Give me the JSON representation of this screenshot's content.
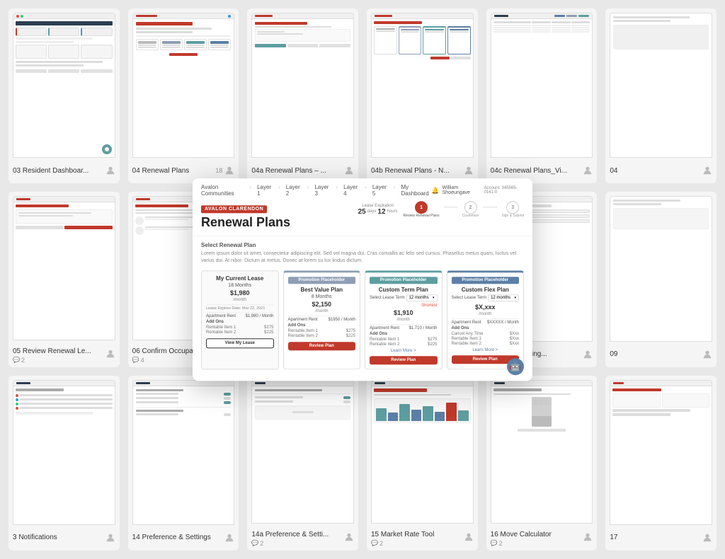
{
  "cards": [
    {
      "id": "c1",
      "title": "03 Resident Dashboar...",
      "comments": null,
      "col": 1,
      "row": 1
    },
    {
      "id": "c2",
      "title": "04 Renewal Plans",
      "comments": "18",
      "col": 2,
      "row": 1
    },
    {
      "id": "c3",
      "title": "04a Renewal Plans – ...",
      "comments": null,
      "col": 3,
      "row": 1
    },
    {
      "id": "c4",
      "title": "04b Renewal Plans - N...",
      "comments": null,
      "col": 4,
      "row": 1
    },
    {
      "id": "c5",
      "title": "04c Renewal Plans_Vi...",
      "comments": null,
      "col": 5,
      "row": 1
    },
    {
      "id": "c6",
      "title": "04",
      "comments": null,
      "col": 6,
      "row": 1
    },
    {
      "id": "c7",
      "title": "05 Review Renewal Le...",
      "comments": "2",
      "col": 1,
      "row": 2
    },
    {
      "id": "c8",
      "title": "06 Confirm Occupants",
      "comments": "4",
      "col": 2,
      "row": 2
    },
    {
      "id": "c9",
      "title": "nfirm Furnishing...",
      "comments": null,
      "col": 5,
      "row": 2
    },
    {
      "id": "c10",
      "title": "09",
      "comments": null,
      "col": 6,
      "row": 2
    },
    {
      "id": "c11",
      "title": "3 Notifications",
      "comments": null,
      "col": 1,
      "row": 3
    },
    {
      "id": "c12",
      "title": "14 Preference & Settings",
      "comments": null,
      "col": 2,
      "row": 3
    },
    {
      "id": "c13",
      "title": "14a Preference & Setti...",
      "comments": "2",
      "col": 3,
      "row": 3
    },
    {
      "id": "c14",
      "title": "15 Market Rate Tool",
      "comments": "2",
      "col": 4,
      "row": 3
    },
    {
      "id": "c15",
      "title": "16 Move Calculator",
      "comments": "2",
      "col": 5,
      "row": 3
    },
    {
      "id": "c16",
      "title": "17",
      "comments": null,
      "col": 6,
      "row": 3
    }
  ],
  "overlay": {
    "brand": "AVALON CLARENDON",
    "title": "Renewal Plans",
    "nav_items": [
      "Avalon Communities",
      "Layer 1",
      "Layer 2",
      "Layer 3",
      "Layer 4",
      "Layer 5",
      "My Dashboard"
    ],
    "user": "William Shoeungave",
    "account": "Account: 345565-0141-0",
    "notification_icon": "🔔",
    "lease_expiry_label": "Lease Expiration",
    "days_label": "25",
    "hours_label": "12",
    "steps": [
      {
        "number": "1",
        "label": "Review\nRenewal Plans",
        "active": true
      },
      {
        "number": "2",
        "label": "Customize",
        "active": false
      },
      {
        "number": "3",
        "label": "Sign\n& Submit",
        "active": false
      }
    ],
    "section_title": "Select Renewal Plan",
    "section_desc": "Lorem ipsum dolor sit amet, consectetur adipiscing elit. Sed vel magna dui. Cras convallis ac felis sed cursus. Phasellus metus quam, luctus vel varius dui. At nibor. Dictum at metus. Donec at lorem su lux lindus dictum.",
    "plans": [
      {
        "type": "current",
        "name": "My Current Lease",
        "duration": "18 Months",
        "price": "$1,980",
        "price_suffix": "/month",
        "lease_expiry": "Lease Expires Date: Mar 22, 2021",
        "rent_label": "Apartment Rent",
        "rent_value": "$1,980 / Month",
        "addons_title": "Add Ons",
        "addon1_name": "Rentable Item 1",
        "addon1_price": "$275",
        "addon2_name": "Rentable Item 2",
        "addon2_price": "$225",
        "button_label": "View My Lease",
        "button_type": "outline"
      },
      {
        "type": "promo",
        "promo_label": "Promotion Placeholder",
        "promo_color": "blue",
        "name": "Best Value Plan",
        "duration": "8 Months",
        "price": "$2,150",
        "price_suffix": "/month",
        "rent_label": "Apartment Rent",
        "rent_value": "$1950 / Month",
        "addons_title": "Add Ons",
        "addon1_name": "Rentable Item 1",
        "addon1_price": "$275",
        "addon2_name": "Rentable Item 2",
        "addon2_price": "$225",
        "button_label": "Review Plan",
        "button_type": "red"
      },
      {
        "type": "promo",
        "promo_label": "Promotion Placeholder",
        "promo_color": "teal",
        "name": "Custom Term Plan",
        "duration": "12 months",
        "price": "$1,910",
        "price_suffix": "/month",
        "select_label": "Select\nLease Term",
        "select_value": "12 months",
        "select_tag": "Shortest",
        "rent_label": "Apartment Rent",
        "rent_value": "$1,710 / Month",
        "addons_title": "Add Ons",
        "addon1_name": "Rentable Item 1",
        "addon1_price": "$275",
        "addon2_name": "Rentable Item 2",
        "addon2_price": "$225",
        "button_label": "Review Plan",
        "button_type": "red",
        "learn_more": "Learn More >"
      },
      {
        "type": "promo",
        "promo_label": "Promotion Placeholder",
        "promo_color": "navy",
        "name": "Custom Flex Plan",
        "duration": "12 months",
        "price": "$X,xxx",
        "price_suffix": "/month",
        "select_label": "Select\nLease Term",
        "select_value": "12 months",
        "rent_label": "Apartment Rent",
        "rent_value": "$XXXXX / Month",
        "addons_title": "Add Ons",
        "cancel_label": "Cancel Any Time",
        "cancel_price": "$Xxx",
        "addon1_name": "Rentable Item 1",
        "addon1_price": "$Xxx",
        "addon2_name": "Rentable Item 2",
        "addon2_price": "$Xxx",
        "button_label": "Review Plan",
        "button_type": "red",
        "learn_more": "Learn More >"
      }
    ],
    "chatbot_icon": "🤖"
  },
  "bottom_labels": {
    "preference_settings": "Preference Settings",
    "notifications": "Notifications"
  }
}
